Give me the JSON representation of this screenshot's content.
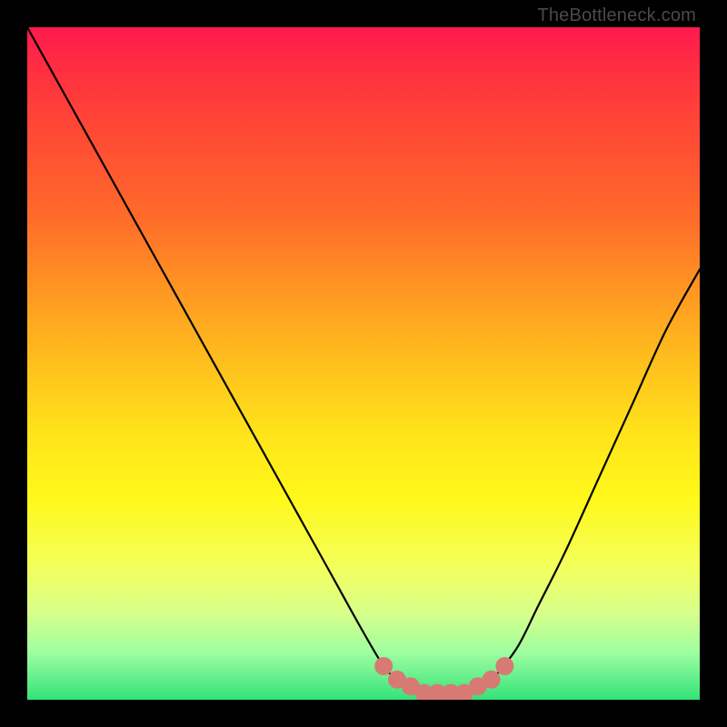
{
  "attribution": "TheBottleneck.com",
  "chart_data": {
    "type": "line",
    "title": "",
    "xlabel": "",
    "ylabel": "",
    "xlim": [
      0,
      100
    ],
    "ylim": [
      0,
      100
    ],
    "series": [
      {
        "name": "bottleneck-curve",
        "x": [
          0,
          5,
          10,
          15,
          20,
          25,
          30,
          35,
          40,
          45,
          50,
          53,
          55,
          58,
          62,
          65,
          68,
          70,
          73,
          76,
          80,
          85,
          90,
          95,
          100
        ],
        "values": [
          100,
          91,
          82,
          73,
          64,
          55,
          46,
          37,
          28,
          19,
          10,
          5,
          3,
          1,
          1,
          1,
          2,
          4,
          8,
          14,
          22,
          33,
          44,
          55,
          64
        ]
      }
    ],
    "markers": {
      "name": "highlight-points",
      "color": "#d87a74",
      "x": [
        53,
        55,
        57,
        59,
        61,
        63,
        65,
        67,
        69,
        71
      ],
      "values": [
        5,
        3,
        2,
        1,
        1,
        1,
        1,
        2,
        3,
        5
      ]
    },
    "background_gradient_meaning": "red at top = high bottleneck, green at bottom = low bottleneck"
  }
}
